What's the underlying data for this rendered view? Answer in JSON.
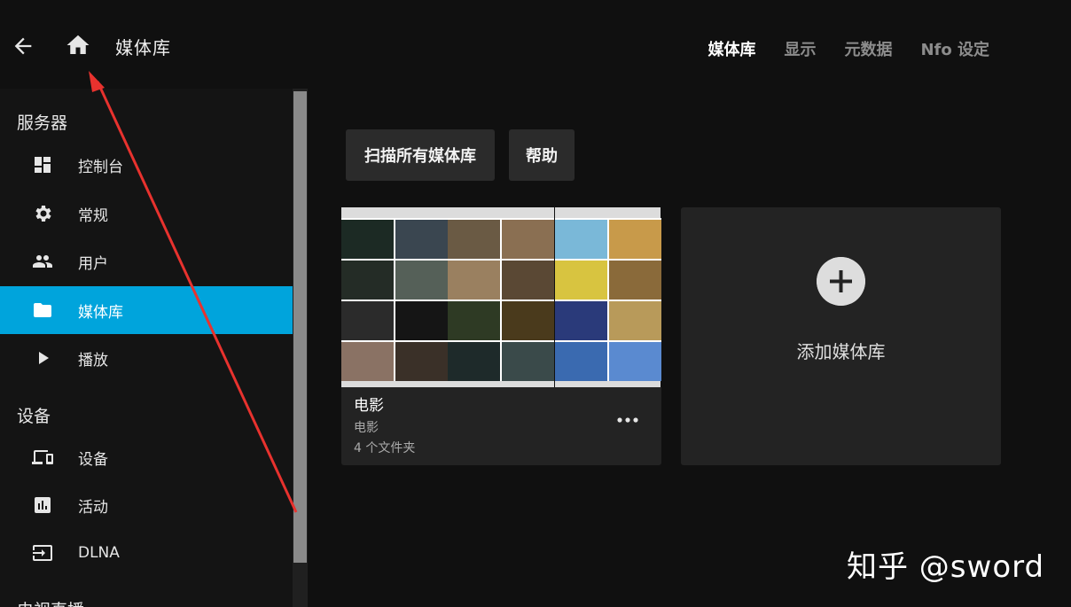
{
  "header": {
    "title": "媒体库",
    "tabs": [
      {
        "label": "媒体库",
        "active": true
      },
      {
        "label": "显示",
        "active": false
      },
      {
        "label": "元数据",
        "active": false
      },
      {
        "label": "Nfo 设定",
        "active": false
      }
    ]
  },
  "sidebar": {
    "sections": [
      {
        "label": "服务器"
      },
      {
        "label": "设备"
      },
      {
        "label": "电视直播"
      }
    ],
    "items": [
      {
        "label": "控制台",
        "icon": "dashboard-icon"
      },
      {
        "label": "常规",
        "icon": "gear-icon"
      },
      {
        "label": "用户",
        "icon": "people-icon"
      },
      {
        "label": "媒体库",
        "icon": "folder-icon",
        "active": true
      },
      {
        "label": "播放",
        "icon": "play-icon"
      },
      {
        "label": "设备",
        "icon": "devices-icon"
      },
      {
        "label": "活动",
        "icon": "bar-chart-icon"
      },
      {
        "label": "DLNA",
        "icon": "input-icon"
      }
    ]
  },
  "main": {
    "buttons": {
      "scan_all": "扫描所有媒体库",
      "help": "帮助"
    },
    "library_card": {
      "name": "电影",
      "type": "电影",
      "folder_count": "4 个文件夹"
    },
    "add_card": {
      "label": "添加媒体库"
    }
  },
  "watermark": "知乎 @sword",
  "colors": {
    "accent": "#00a4dc",
    "background": "#101010",
    "card": "#232323",
    "annotation_arrow": "#e8322e"
  }
}
